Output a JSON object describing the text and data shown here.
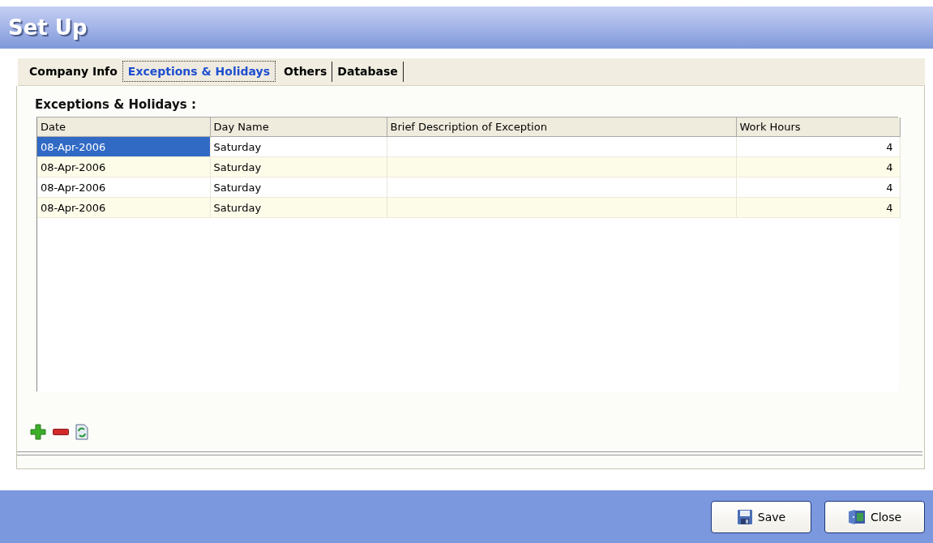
{
  "window": {
    "title": "Set Up"
  },
  "tabs": [
    {
      "label": "Company Info",
      "selected": false
    },
    {
      "label": "Exceptions & Holidays",
      "selected": true
    },
    {
      "label": "Others",
      "selected": false
    },
    {
      "label": "Database",
      "selected": false
    }
  ],
  "section_title": "Exceptions & Holidays :",
  "table": {
    "columns": [
      "Date",
      "Day Name",
      "Brief Description of Exception",
      "Work Hours"
    ],
    "rows": [
      {
        "date": "08-Apr-2006",
        "day": "Saturday",
        "description": "",
        "hours": "4",
        "selected": true
      },
      {
        "date": "08-Apr-2006",
        "day": "Saturday",
        "description": "",
        "hours": "4",
        "selected": false
      },
      {
        "date": "08-Apr-2006",
        "day": "Saturday",
        "description": "",
        "hours": "4",
        "selected": false
      },
      {
        "date": "08-Apr-2006",
        "day": "Saturday",
        "description": "",
        "hours": "4",
        "selected": false
      }
    ]
  },
  "buttons": [
    {
      "kind": "save",
      "label": "Save"
    },
    {
      "kind": "close",
      "label": "Close"
    }
  ]
}
